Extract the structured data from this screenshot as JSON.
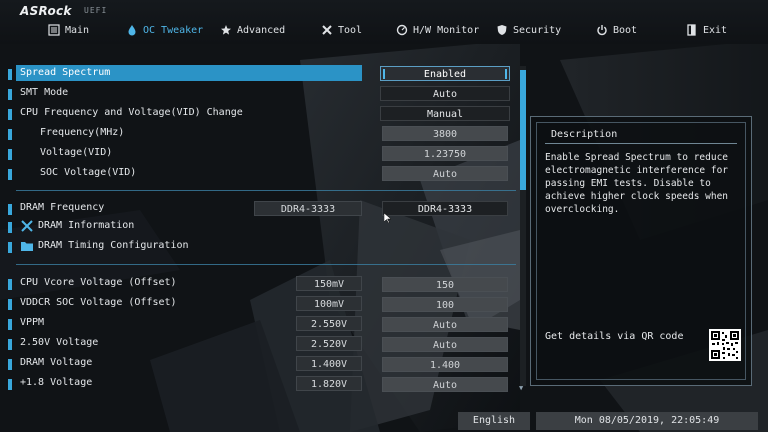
{
  "brand": {
    "logo": "ASRock",
    "tag": "UEFI"
  },
  "nav": [
    {
      "label": "Main",
      "icon": "main-list-icon"
    },
    {
      "label": "OC Tweaker",
      "icon": "droplet-icon",
      "active": true
    },
    {
      "label": "Advanced",
      "icon": "star-icon"
    },
    {
      "label": "Tool",
      "icon": "tools-icon"
    },
    {
      "label": "H/W Monitor",
      "icon": "monitor-icon"
    },
    {
      "label": "Security",
      "icon": "shield-icon"
    },
    {
      "label": "Boot",
      "icon": "power-icon"
    },
    {
      "label": "Exit",
      "icon": "exit-icon"
    }
  ],
  "settings": {
    "spread_spectrum": {
      "label": "Spread Spectrum",
      "value": "Enabled"
    },
    "smt_mode": {
      "label": "SMT Mode",
      "value": "Auto"
    },
    "cpu_freq_change": {
      "label": "CPU Frequency and Voltage(VID) Change",
      "value": "Manual"
    },
    "frequency": {
      "label": "Frequency(MHz)",
      "value": "3800"
    },
    "voltage_vid": {
      "label": "Voltage(VID)",
      "value": "1.23750"
    },
    "soc_voltage_vid": {
      "label": "SOC Voltage(VID)",
      "value": "Auto"
    },
    "dram_frequency": {
      "label": "DRAM Frequency",
      "current": "DDR4-3333",
      "value": "DDR4-3333"
    },
    "dram_information": {
      "label": "DRAM Information"
    },
    "dram_timing": {
      "label": "DRAM Timing Configuration"
    },
    "cpu_vcore": {
      "label": "CPU Vcore Voltage (Offset)",
      "current": "150mV",
      "value": "150"
    },
    "vddcr_soc": {
      "label": "VDDCR SOC Voltage (Offset)",
      "current": "100mV",
      "value": "100"
    },
    "vppm": {
      "label": "VPPM",
      "current": "2.550V",
      "value": "Auto"
    },
    "v250": {
      "label": "2.50V Voltage",
      "current": "2.520V",
      "value": "Auto"
    },
    "dram_voltage": {
      "label": "DRAM Voltage",
      "current": "1.400V",
      "value": "1.400"
    },
    "v18": {
      "label": "+1.8 Voltage",
      "current": "1.820V",
      "value": "Auto"
    }
  },
  "description": {
    "title": "Description",
    "text": "Enable Spread Spectrum to reduce electromagnetic interference for passing EMI tests. Disable to achieve higher clock speeds when overclocking.",
    "qr_label": "Get details via QR code"
  },
  "footer": {
    "language": "English",
    "datetime": "Mon 08/05/2019, 22:05:49"
  },
  "colors": {
    "accent": "#39a8dc",
    "selected_row": "#2b93c6",
    "value_box": "#3a3e42"
  }
}
